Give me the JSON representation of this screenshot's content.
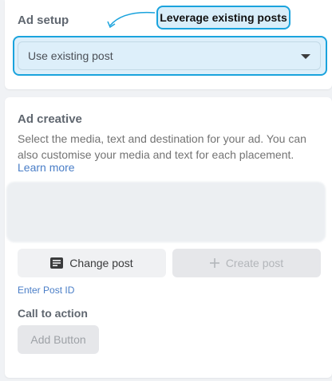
{
  "ad_setup": {
    "title": "Ad setup",
    "callout": "Leverage existing posts",
    "select_value": "Use existing post"
  },
  "ad_creative": {
    "title": "Ad creative",
    "description": "Select the media, text and destination for your ad. You can also customise your media and text for each placement.",
    "learn_more": "Learn more",
    "change_post": "Change post",
    "create_post": "Create post",
    "enter_post_id": "Enter Post ID",
    "cta_label": "Call to action",
    "add_button": "Add Button"
  },
  "colors": {
    "accent": "#1aa3dd",
    "highlight": "#d8eefa",
    "link": "#4a7ec7"
  }
}
